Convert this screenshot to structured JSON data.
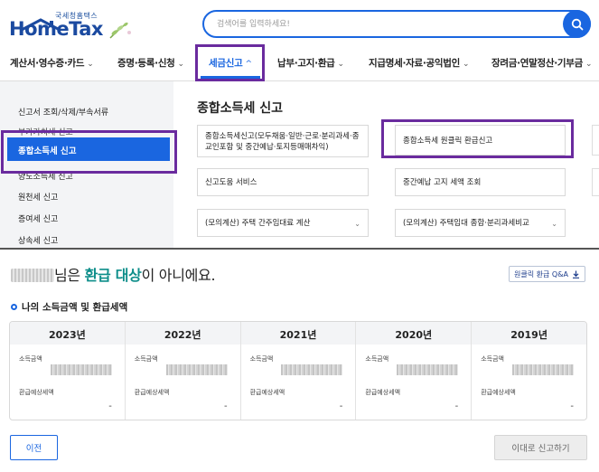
{
  "header": {
    "logo_sub": "국세청홈택스",
    "logo_main": "HomeTax",
    "search_placeholder": "검색어를 입력하세요!"
  },
  "nav": {
    "items": [
      {
        "label": "계산서·영수증·카드"
      },
      {
        "label": "증명·등록·신청"
      },
      {
        "label": "세금신고"
      },
      {
        "label": "납부·고지·환급"
      },
      {
        "label": "지급명세·자료·공익법인"
      },
      {
        "label": "장려금·연말정산·기부금"
      }
    ],
    "active_index": 2
  },
  "sidemenu": {
    "items": [
      {
        "label": "신고서 조회/삭제/부속서류"
      },
      {
        "label": "부가가치세 신고"
      },
      {
        "label": "종합소득세 신고"
      },
      {
        "label": "양도소득세 신고"
      },
      {
        "label": "원천세 신고"
      },
      {
        "label": "증여세 신고"
      },
      {
        "label": "상속세 신고"
      }
    ],
    "active_index": 2
  },
  "panel": {
    "title": "종합소득세 신고",
    "cards": [
      {
        "label": "종합소득세신고(모두채움·일반·근로·분리과세·종교인포함 및 중간예납·토지등매매차익)"
      },
      {
        "label": "종합소득세 원클릭 환급신고"
      },
      {
        "label": "신고도움 서비스"
      },
      {
        "label": "중간예납 고지 세액 조회"
      },
      {
        "label": "(모의계산) 주택 간주임대료 계산"
      },
      {
        "label": "(모의계산) 주택임대 종합·분리과세비교"
      }
    ]
  },
  "result": {
    "title_suffix": "님은 ",
    "title_highlight": "환급 대상",
    "title_end": "이 아니에요.",
    "qa_button": "원클릭 환급 Q&A",
    "section_title": "나의 소득금액 및 환급세액",
    "income_label": "소득금액",
    "refund_label": "환급예상세액",
    "years": [
      {
        "year": "2023년",
        "refund": "-"
      },
      {
        "year": "2022년",
        "refund": "-"
      },
      {
        "year": "2021년",
        "refund": "-"
      },
      {
        "year": "2020년",
        "refund": "-"
      },
      {
        "year": "2019년",
        "refund": "-"
      }
    ],
    "prev_button": "이전",
    "later_button": "이대로 신고하기"
  },
  "colors": {
    "brand_blue": "#1a66e0",
    "highlight_purple": "#6a2b9e",
    "teal": "#0e8e8a"
  }
}
